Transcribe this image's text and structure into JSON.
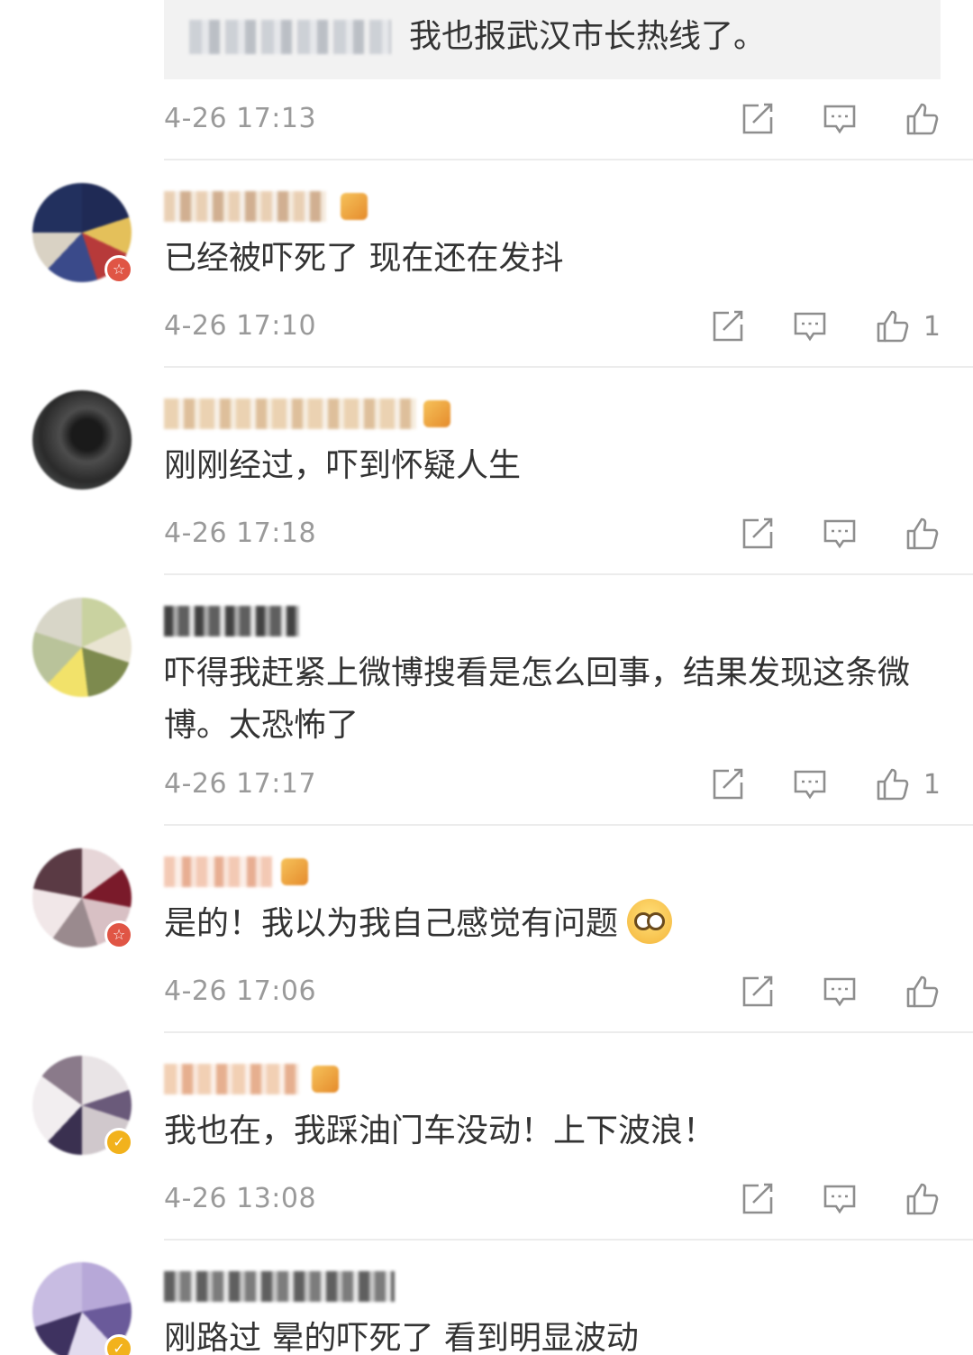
{
  "top_reply": {
    "text": "我也报武汉市长热线了。",
    "time": "4-26 17:13"
  },
  "comments": [
    {
      "text": "已经被吓死了 现在还在发抖",
      "time": "4-26 17:10",
      "likes": "1",
      "badge": "red"
    },
    {
      "text": "刚刚经过，吓到怀疑人生",
      "time": "4-26 17:18",
      "likes": "",
      "badge": ""
    },
    {
      "text": "吓得我赶紧上微博搜看是怎么回事，结果发现这条微博。太恐怖了",
      "time": "4-26 17:17",
      "likes": "1",
      "badge": ""
    },
    {
      "text": "是的！我以为我自己感觉有问题",
      "emoji": "dizzy-face-emoji",
      "time": "4-26 17:06",
      "likes": "",
      "badge": "red"
    },
    {
      "text": "我也在，我踩油门车没动！上下波浪！",
      "time": "4-26 13:08",
      "likes": "",
      "badge": "gold"
    },
    {
      "text": "刚路过 晕的吓死了 看到明显波动",
      "badge": "gold"
    }
  ],
  "icons": {
    "repost": "repost-icon",
    "comment": "comment-icon",
    "like": "thumbs-up-icon"
  },
  "colors": {
    "text": "#333333",
    "meta": "#9a9a9a",
    "divider": "#ececec",
    "reply_bg": "#f2f2f2",
    "badge_red": "#e05545",
    "badge_gold": "#f2b21c"
  }
}
